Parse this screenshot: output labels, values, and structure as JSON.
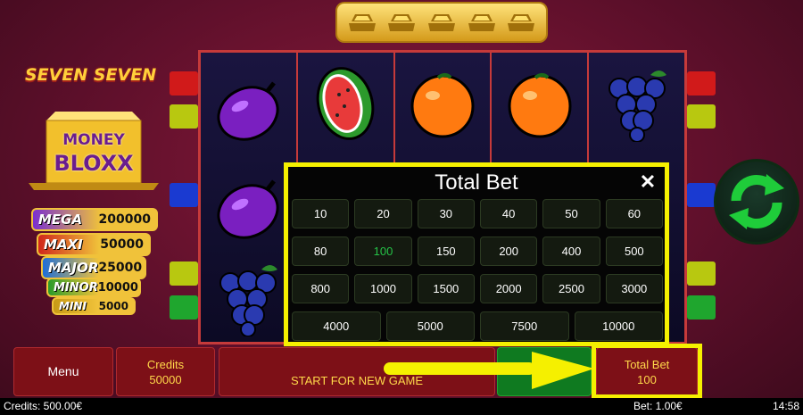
{
  "title_logo": {
    "line1": "SEVEN SEVEN",
    "line2a": "MONEY",
    "line2b": "BLOXX"
  },
  "jackpots": [
    {
      "label": "MEGA",
      "value": "200000",
      "color": "#7a2fd0"
    },
    {
      "label": "MAXI",
      "value": "50000",
      "color": "#d0281c"
    },
    {
      "label": "MAJOR",
      "value": "25000",
      "color": "#1e6ed8"
    },
    {
      "label": "MINOR",
      "value": "10000",
      "color": "#2a9c2a"
    },
    {
      "label": "MINI",
      "value": "5000",
      "color": "#c79a16"
    }
  ],
  "reels": [
    [
      "plum",
      "plum",
      "grapes"
    ],
    [
      "watermelon",
      "",
      ""
    ],
    [
      "orange",
      "",
      ""
    ],
    [
      "orange",
      "",
      ""
    ],
    [
      "grapes",
      "",
      ""
    ]
  ],
  "modal": {
    "title": "Total Bet",
    "close_icon": "close-icon",
    "options": [
      "10",
      "20",
      "30",
      "40",
      "50",
      "60",
      "80",
      "100",
      "150",
      "200",
      "400",
      "500",
      "800",
      "1000",
      "1500",
      "2000",
      "2500",
      "3000",
      "4000",
      "5000",
      "7500",
      "10000"
    ],
    "selected": "100"
  },
  "bottom": {
    "menu": "Menu",
    "credits_label": "Credits",
    "credits_value": "50000",
    "start": "START FOR NEW GAME",
    "total_bet_label": "Total Bet",
    "total_bet_value": "100"
  },
  "status": {
    "credits": "Credits: 500.00€",
    "bet": "Bet: 1.00€",
    "time": "14:58"
  },
  "colors": {
    "highlight": "#f5f000",
    "selected_option": "#25c247",
    "panel": "#7d1017"
  }
}
